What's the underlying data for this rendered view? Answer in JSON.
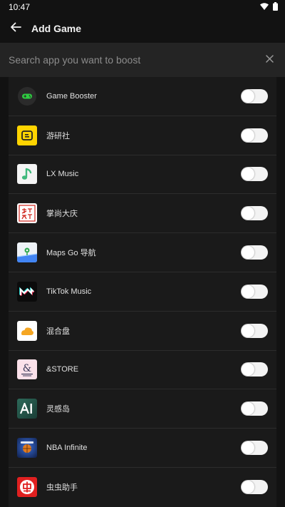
{
  "status_bar": {
    "time": "10:47"
  },
  "app_bar": {
    "title": "Add Game"
  },
  "search": {
    "placeholder": "Search app you want to boost",
    "value": ""
  },
  "apps": [
    {
      "name": "Game Booster",
      "icon": "game-booster-icon",
      "enabled": false
    },
    {
      "name": "游研社",
      "icon": "youyanshe-icon",
      "enabled": false
    },
    {
      "name": "LX Music",
      "icon": "lx-music-icon",
      "enabled": false
    },
    {
      "name": "掌尚大庆",
      "icon": "zhangshang-daqing-icon",
      "enabled": false
    },
    {
      "name": "Maps Go 导航",
      "icon": "maps-go-icon",
      "enabled": false
    },
    {
      "name": "TikTok Music",
      "icon": "tiktok-music-icon",
      "enabled": false
    },
    {
      "name": "混合盘",
      "icon": "hunhepan-icon",
      "enabled": false
    },
    {
      "name": "&STORE",
      "icon": "andstore-icon",
      "enabled": false
    },
    {
      "name": "灵感岛",
      "icon": "linggandao-icon",
      "enabled": false
    },
    {
      "name": "NBA Infinite",
      "icon": "nba-infinite-icon",
      "enabled": false
    },
    {
      "name": "虫虫助手",
      "icon": "chongchong-icon",
      "enabled": false
    }
  ],
  "colors": {
    "background": "#121212",
    "search_bar": "#242424",
    "list_background": "#1a1a1a",
    "toggle_off": "#f3f3f3"
  }
}
